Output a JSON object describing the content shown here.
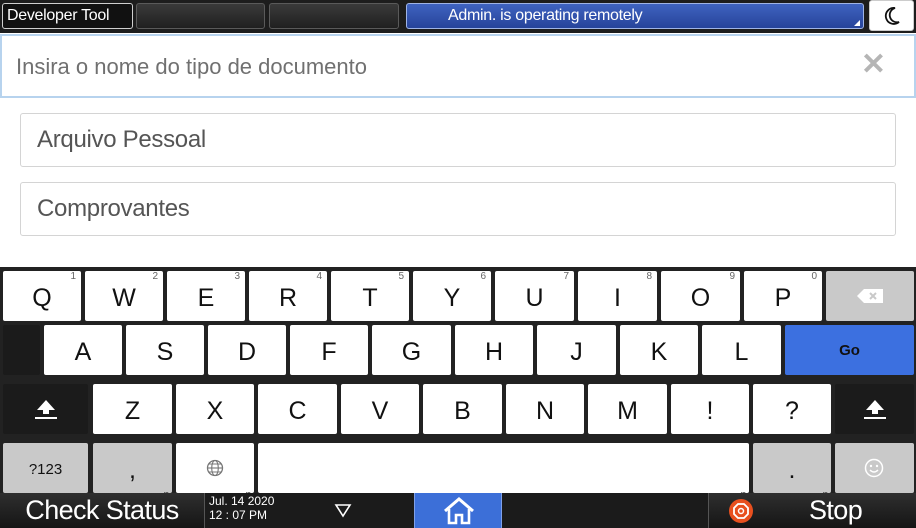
{
  "topbar": {
    "developer_tool": "Developer Tool",
    "status_message": "Admin. is operating remotely",
    "night_mode_icon": "moon-icon"
  },
  "search": {
    "placeholder": "Insira o nome do tipo de documento",
    "value": "",
    "clear_icon": "close-icon"
  },
  "list": {
    "items": [
      {
        "label": "Arquivo Pessoal"
      },
      {
        "label": "Comprovantes"
      }
    ]
  },
  "keyboard": {
    "row1": [
      {
        "key": "Q",
        "num": "1"
      },
      {
        "key": "W",
        "num": "2"
      },
      {
        "key": "E",
        "num": "3"
      },
      {
        "key": "R",
        "num": "4"
      },
      {
        "key": "T",
        "num": "5"
      },
      {
        "key": "Y",
        "num": "6"
      },
      {
        "key": "U",
        "num": "7"
      },
      {
        "key": "I",
        "num": "8"
      },
      {
        "key": "O",
        "num": "9"
      },
      {
        "key": "P",
        "num": "0"
      }
    ],
    "row2": [
      "A",
      "S",
      "D",
      "F",
      "G",
      "H",
      "J",
      "K",
      "L"
    ],
    "row3": [
      "Z",
      "X",
      "C",
      "V",
      "B",
      "N",
      "M",
      "!",
      "?"
    ],
    "go_label": "Go",
    "numbers_label": "?123",
    "comma_label": ",",
    "period_label": ".",
    "more_dots": "...",
    "backspace_icon": "backspace-icon",
    "shift_icon": "shift-icon",
    "globe_icon": "globe-icon",
    "emoji_icon": "emoji-icon"
  },
  "bottombar": {
    "check_status": "Check Status",
    "date": "Jul. 14 2020",
    "time": "12 : 07 PM",
    "dropdown_icon": "triangle-down-icon",
    "home_icon": "home-icon",
    "stop_icon": "stop-icon",
    "stop_label": "Stop",
    "home_color": "#3c6fd8",
    "stop_color": "#e8501f"
  }
}
